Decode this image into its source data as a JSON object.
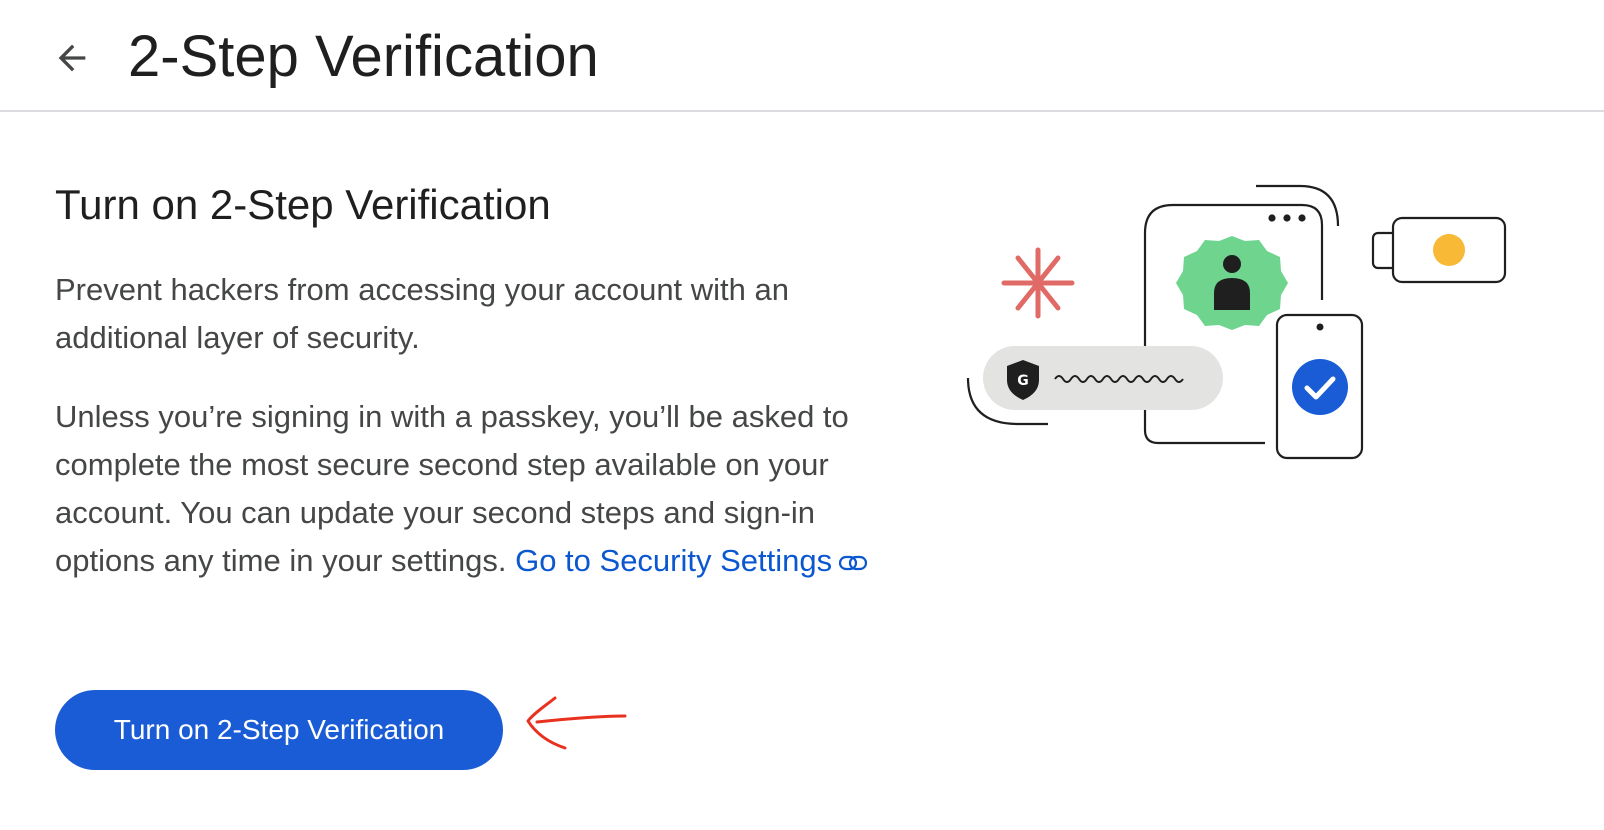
{
  "header": {
    "back_icon": "arrow-back-icon",
    "title": "2-Step Verification"
  },
  "main": {
    "section_title": "Turn on 2-Step Verification",
    "paragraph_1": "Prevent hackers from accessing your account with an additional layer of security.",
    "paragraph_2": "Unless you’re signing in with a passkey, you’ll be asked to complete the most secure second step available on your account. You can update your second steps and sign-in options any time in your settings.",
    "security_link_label": "Go to Security Settings",
    "security_link_icon": "link-icon",
    "primary_button_label": "Turn on 2-Step Verification"
  },
  "illustration": {
    "shield_letter": "G"
  },
  "colors": {
    "primary_blue": "#1a5cd6",
    "link_blue": "#0b57d0",
    "title_text": "#1f1f1f",
    "body_text": "#444746",
    "divider": "#dadce0",
    "annotation_red": "#e8321f",
    "asterisk_red": "#e06a66",
    "badge_green": "#6fd48e",
    "key_yellow": "#f8b936",
    "check_blue": "#1a5cd6",
    "password_pill": "#e3e4e1"
  }
}
